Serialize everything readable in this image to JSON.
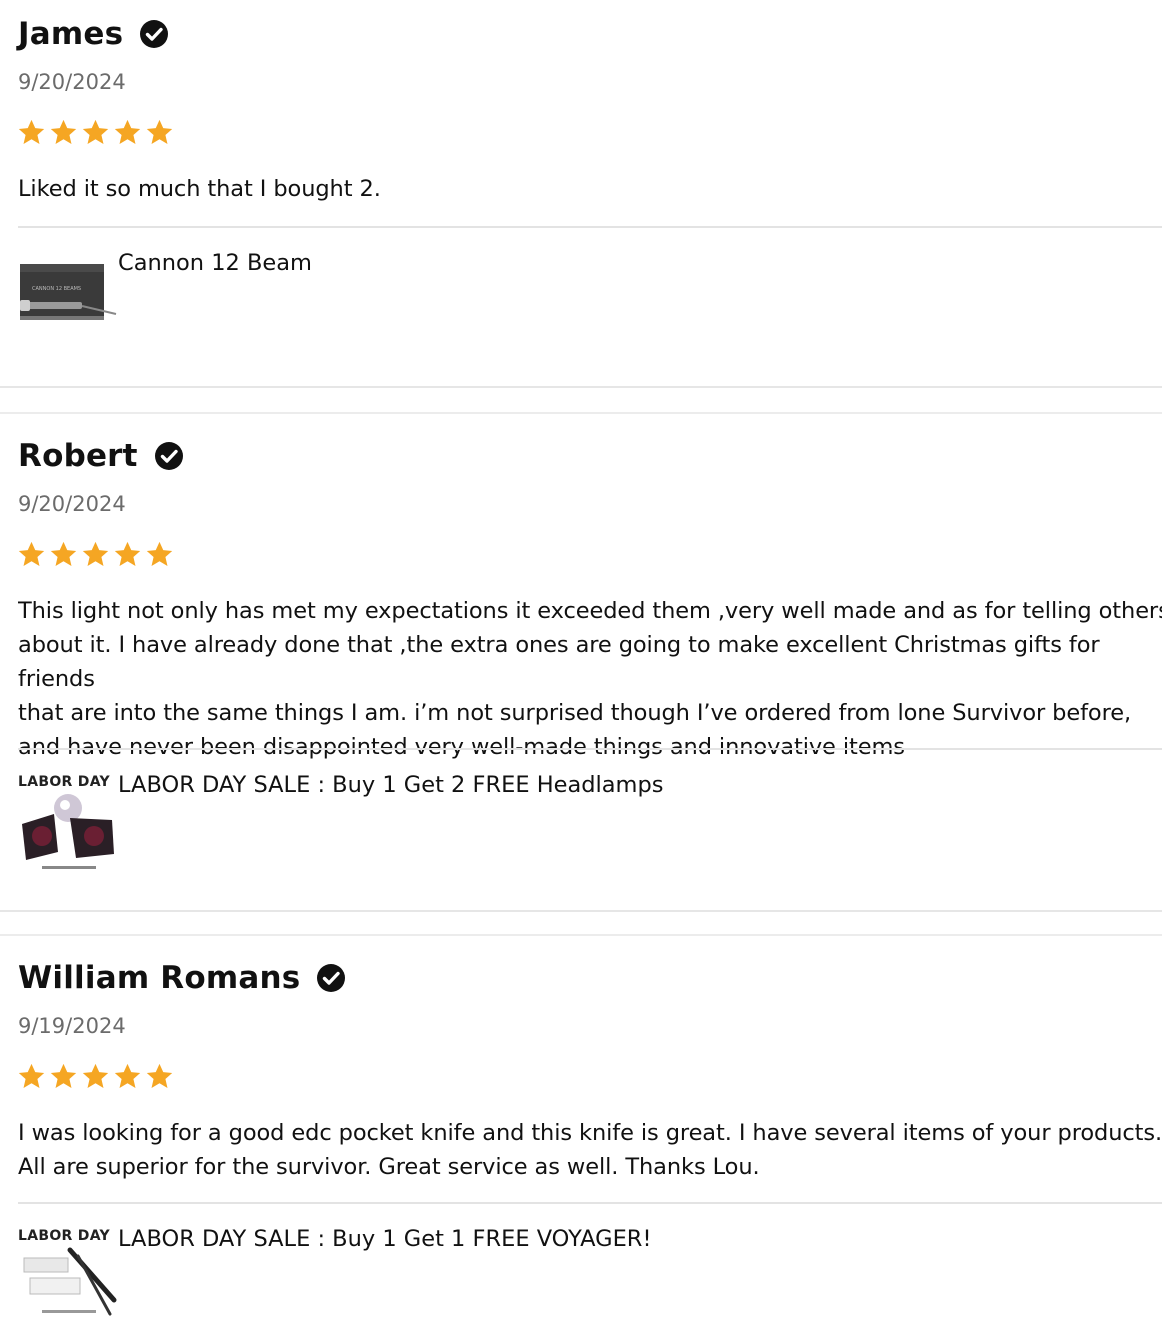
{
  "colors": {
    "star": "#f5a623",
    "verified": "#111111",
    "date": "#6b6b6b",
    "divider": "#e3e3e3"
  },
  "reviews": [
    {
      "name": "James",
      "verified_icon": "verified-check-icon",
      "date": "9/20/2024",
      "rating": 5,
      "text": "Liked it so much that I bought 2.",
      "product": {
        "name": "Cannon 12 Beam",
        "thumb_icon": "flashlight-box-thumbnail"
      }
    },
    {
      "name": "Robert",
      "verified_icon": "verified-check-icon",
      "date": "9/20/2024",
      "rating": 5,
      "text": "This light not only has met my expectations it exceeded them ,very well made and as for telling others\nabout it. I have already done that ,the extra ones are going to make excellent Christmas gifts for friends\nthat are into the same things I am. i’m not surprised though I’ve ordered from lone Survivor before,\nand have never been disappointed very well-made things and innovative items",
      "product": {
        "name": "LABOR DAY SALE : Buy 1 Get 2 FREE Headlamps",
        "thumb_label": "LABOR DAY",
        "thumb_icon": "headlamp-bundle-thumbnail"
      }
    },
    {
      "name": "William Romans",
      "verified_icon": "verified-check-icon",
      "date": "9/19/2024",
      "rating": 5,
      "text": "I was looking for a good edc pocket knife and this knife is great. I have several items of your products.\nAll are superior for the survivor. Great service as well. Thanks Lou.",
      "product": {
        "name": "LABOR DAY SALE : Buy 1 Get 1 FREE VOYAGER!",
        "thumb_label": "LABOR DAY",
        "thumb_icon": "voyager-knife-thumbnail"
      }
    }
  ]
}
